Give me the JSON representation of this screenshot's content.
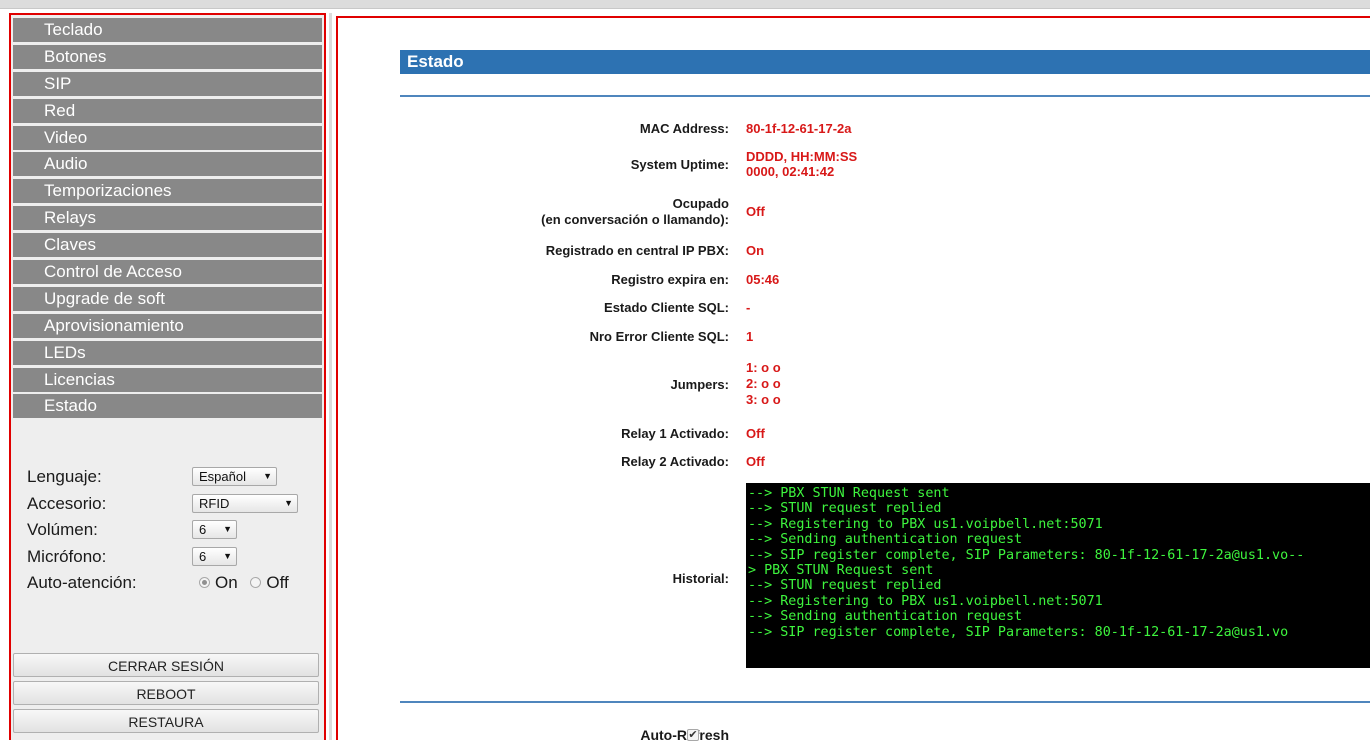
{
  "sidebar": {
    "items": [
      {
        "label": "Teclado"
      },
      {
        "label": "Botones"
      },
      {
        "label": "SIP"
      },
      {
        "label": "Red"
      },
      {
        "label": "Video"
      },
      {
        "label": "Audio"
      },
      {
        "label": "Temporizaciones"
      },
      {
        "label": "Relays"
      },
      {
        "label": "Claves"
      },
      {
        "label": "Control de Acceso"
      },
      {
        "label": "Upgrade de soft"
      },
      {
        "label": "Aprovisionamiento"
      },
      {
        "label": "LEDs"
      },
      {
        "label": "Licencias"
      },
      {
        "label": "Estado"
      }
    ],
    "settings": {
      "language": {
        "label": "Lenguaje:",
        "value": "Español"
      },
      "accessory": {
        "label": "Accesorio:",
        "value": "RFID"
      },
      "volume": {
        "label": "Volúmen:",
        "value": "6"
      },
      "microphone": {
        "label": "Micrófono:",
        "value": "6"
      },
      "auto_answer": {
        "label": "Auto-atención:",
        "on_label": "On",
        "off_label": "Off",
        "selected": "On"
      }
    },
    "buttons": {
      "logout": "CERRAR SESIÓN",
      "reboot": "REBOOT",
      "restore": "RESTAURA"
    }
  },
  "main": {
    "title": "Estado",
    "fields": {
      "mac": {
        "label": "MAC Address:",
        "value": "80-1f-12-61-17-2a"
      },
      "uptime": {
        "label": "System Uptime:",
        "format": "DDDD, HH:MM:SS",
        "value": "0000, 02:41:42"
      },
      "busy": {
        "label_line1": "Ocupado",
        "label_line2": "(en conversación o llamando):",
        "value": "Off"
      },
      "registered": {
        "label": "Registrado en central IP PBX:",
        "value": "On"
      },
      "expires": {
        "label": "Registro expira en:",
        "value": "05:46"
      },
      "sql_state": {
        "label": "Estado Cliente SQL:",
        "value": "-"
      },
      "sql_error": {
        "label": "Nro Error Cliente SQL:",
        "value": "1"
      },
      "jumpers": {
        "label": "Jumpers:",
        "lines": [
          "1: o o",
          "2: o o",
          "3: o o"
        ]
      },
      "relay1": {
        "label": "Relay 1 Activado:",
        "value": "Off"
      },
      "relay2": {
        "label": "Relay 2 Activado:",
        "value": "Off"
      }
    },
    "history": {
      "label": "Historial:",
      "log": "--> PBX STUN Request sent\n--> STUN request replied\n--> Registering to PBX us1.voipbell.net:5071\n--> Sending authentication request\n--> SIP register complete, SIP Parameters: 80-1f-12-61-17-2a@us1.vo--\n> PBX STUN Request sent\n--> STUN request replied\n--> Registering to PBX us1.voipbell.net:5071\n--> Sending authentication request\n--> SIP register complete, SIP Parameters: 80-1f-12-61-17-2a@us1.vo"
    },
    "auto_refresh": {
      "label": "Auto-Refresh",
      "checked": true
    }
  }
}
